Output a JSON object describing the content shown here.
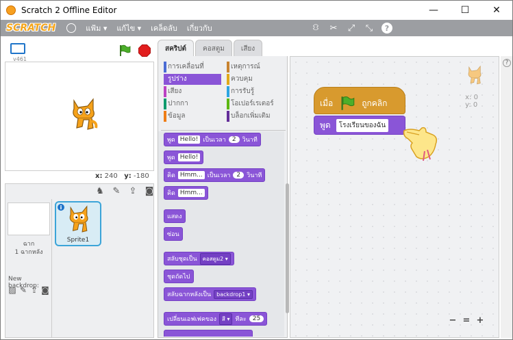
{
  "window": {
    "title": "Scratch 2 Offline Editor",
    "minimize": "—",
    "maximize": "☐",
    "close": "✕"
  },
  "menubar": {
    "logo": "SCRATCH",
    "file": "แฟ้ม ▾",
    "edit": "แก้ไข ▾",
    "tips": "เคล็ดลับ",
    "about": "เกี่ยวกับ"
  },
  "stage": {
    "version": "v461",
    "x_label": "x:",
    "x": "240",
    "y_label": "y:",
    "y": "-180"
  },
  "sprites": {
    "stage_name": "ฉาก",
    "backdrop_count": "1 ฉากหลัง",
    "new_backdrop": "New backdrop:",
    "sprite1_name": "Sprite1",
    "info": "i"
  },
  "tabs": [
    "สคริปต์",
    "คอสตูม",
    "เสียง"
  ],
  "categories": [
    {
      "label": "การเคลื่อนที่",
      "color": "#4a6cd4"
    },
    {
      "label": "เหตุการณ์",
      "color": "#c88330"
    },
    {
      "label": "รูปร่าง",
      "color": "#8a55d7"
    },
    {
      "label": "ควบคุม",
      "color": "#e1a91a"
    },
    {
      "label": "เสียง",
      "color": "#bb42c3"
    },
    {
      "label": "การรับรู้",
      "color": "#2ca5e2"
    },
    {
      "label": "ปากกา",
      "color": "#0e9a6c"
    },
    {
      "label": "โอเปอร์เรเตอร์",
      "color": "#5cb712"
    },
    {
      "label": "ข้อมูล",
      "color": "#ee7d16"
    },
    {
      "label": "บล็อกเพิ่มเติม",
      "color": "#632d99"
    }
  ],
  "blocks": {
    "say_for": {
      "a": "พูด",
      "text": "Hello!",
      "b": "เป็นเวลา",
      "num": "2",
      "c": "วินาที"
    },
    "say": {
      "a": "พูด",
      "text": "Hello!"
    },
    "think_for": {
      "a": "คิด",
      "text": "Hmm...",
      "b": "เป็นเวลา",
      "num": "2",
      "c": "วินาที"
    },
    "think": {
      "a": "คิด",
      "text": "Hmm..."
    },
    "show": "แสดง",
    "hide": "ซ่อน",
    "switch_costume": {
      "a": "สลับชุดเป็น",
      "dd": "คอสตูม2 ▾"
    },
    "next_costume": "ชุดถัดไป",
    "switch_backdrop": {
      "a": "สลับฉากหลังเป็น",
      "dd": "backdrop1 ▾"
    },
    "change_effect": {
      "a": "เปลี่ยนเอฟเฟคของ",
      "dd": "สี ▾",
      "b": "ทีละ",
      "num": "25"
    }
  },
  "script": {
    "hat_a": "เมื่อ",
    "hat_b": "ถูกคลิก",
    "say_a": "พูด",
    "say_text": "โรงเรียนของฉัน",
    "x_label": "x: 0",
    "y_label": "y: 0"
  },
  "zoom": {
    "out": "−",
    "reset": "=",
    "in": "+"
  },
  "help": "?"
}
